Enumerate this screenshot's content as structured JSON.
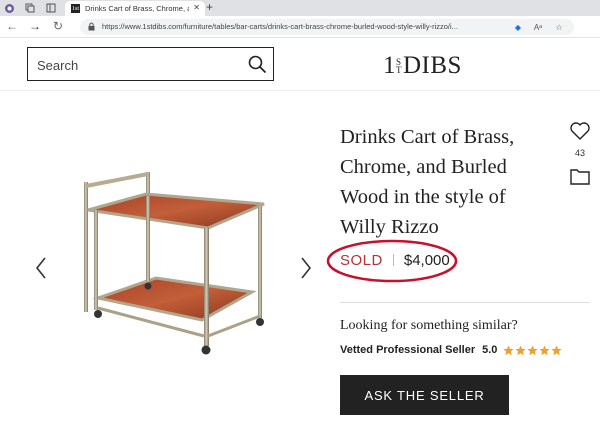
{
  "browser": {
    "tab_title": "Drinks Cart of Brass, Chrome, and",
    "tab_favicon": "1st",
    "url": "https://www.1stdibs.com/furniture/tables/bar-carts/drinks-cart-brass-chrome-burled-wood-style-willy-rizzo/i..."
  },
  "header": {
    "search_placeholder": "Search",
    "logo_pre": "1",
    "logo_st_top": "S",
    "logo_st_bottom": "T",
    "logo_post": "DIBS"
  },
  "product": {
    "title": "Drinks Cart of Brass, Chrome, and Burled Wood in the style of Willy Rizzo",
    "favorites_count": "43",
    "status": "SOLD",
    "price": "$4,000"
  },
  "seller": {
    "prompt": "Looking for something similar?",
    "label": "Vetted Professional Seller",
    "rating": "5.0",
    "stars": 5
  },
  "actions": {
    "ask_seller": "ASK THE SELLER"
  },
  "colors": {
    "accent_red": "#c8102e",
    "star_orange": "#f0a030",
    "button_dark": "#222222"
  }
}
